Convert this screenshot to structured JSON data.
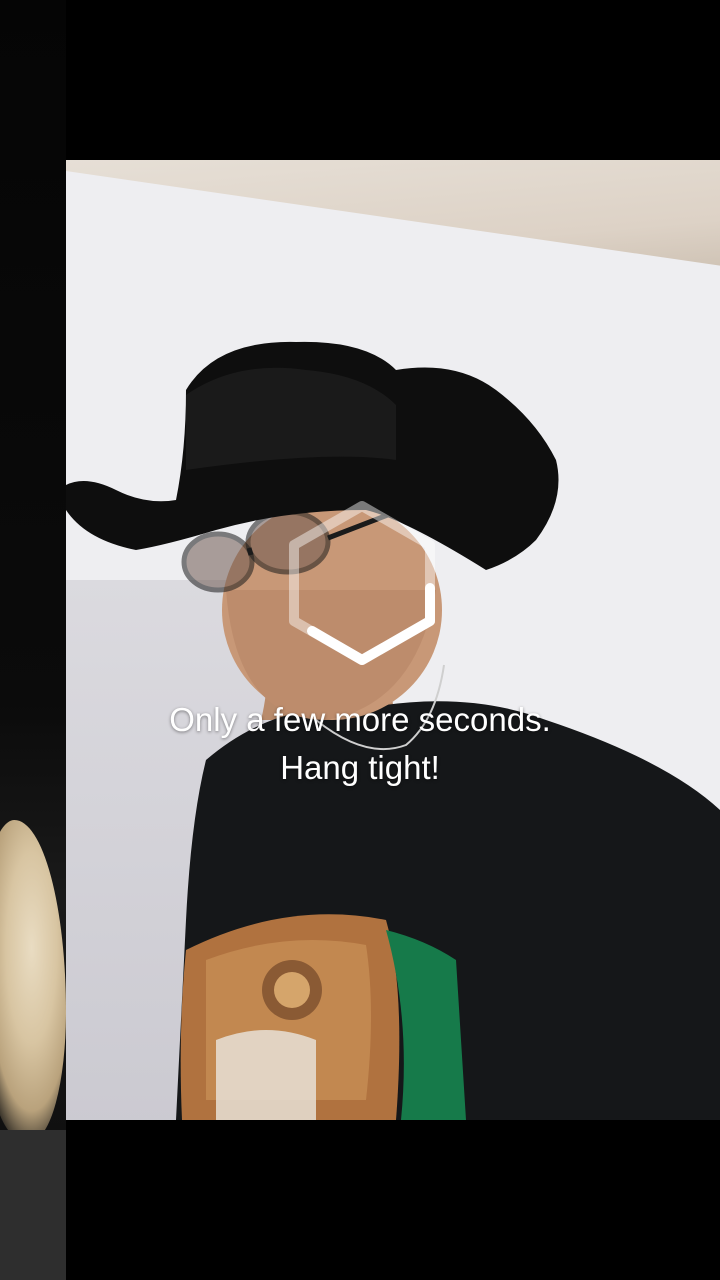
{
  "loading": {
    "line1": "Only a few more seconds.",
    "line2": "Hang tight!",
    "spinner_icon": "hexagon-spinner-icon"
  },
  "colors": {
    "background": "#000000",
    "wall": "#eeeef1",
    "caption_text": "#ffffff"
  }
}
